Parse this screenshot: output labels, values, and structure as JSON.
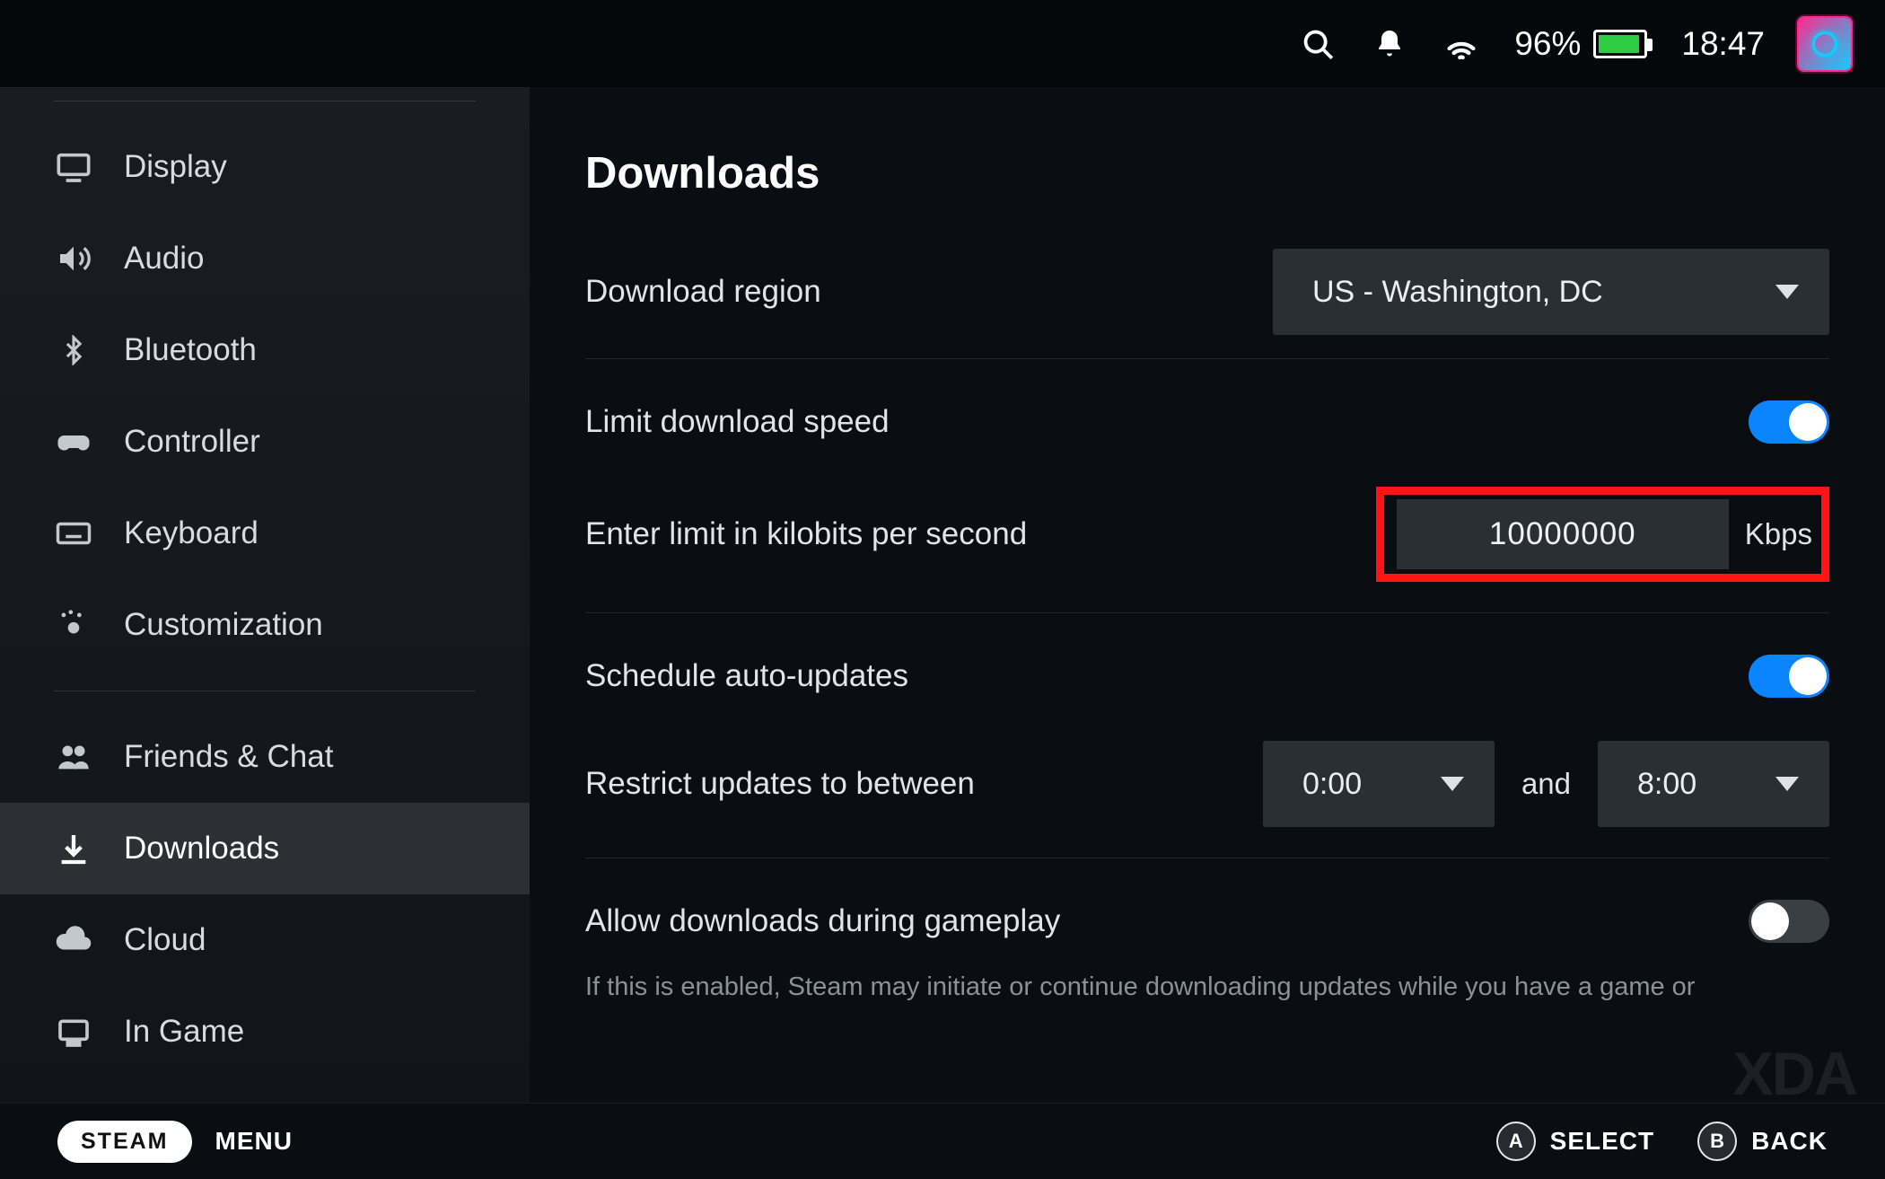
{
  "status": {
    "battery_pct": "96%",
    "battery_fill_pct": 96,
    "time": "18:47"
  },
  "sidebar": {
    "items": [
      {
        "label": "Display",
        "icon": "display-icon"
      },
      {
        "label": "Audio",
        "icon": "audio-icon"
      },
      {
        "label": "Bluetooth",
        "icon": "bluetooth-icon"
      },
      {
        "label": "Controller",
        "icon": "controller-icon"
      },
      {
        "label": "Keyboard",
        "icon": "keyboard-icon"
      },
      {
        "label": "Customization",
        "icon": "customization-icon"
      },
      {
        "label": "Friends & Chat",
        "icon": "friends-icon"
      },
      {
        "label": "Downloads",
        "icon": "download-icon",
        "active": true
      },
      {
        "label": "Cloud",
        "icon": "cloud-icon"
      },
      {
        "label": "In Game",
        "icon": "ingame-icon"
      }
    ]
  },
  "page": {
    "title": "Downloads",
    "region_label": "Download region",
    "region_value": "US - Washington, DC",
    "limit_toggle_label": "Limit download speed",
    "limit_toggle_on": true,
    "limit_input_label": "Enter limit in kilobits per second",
    "limit_input_value": "10000000",
    "limit_unit": "Kbps",
    "schedule_label": "Schedule auto-updates",
    "schedule_toggle_on": true,
    "restrict_label": "Restrict updates to between",
    "restrict_from": "0:00",
    "restrict_and": "and",
    "restrict_to": "8:00",
    "gameplay_label": "Allow downloads during gameplay",
    "gameplay_toggle_on": false,
    "gameplay_help": "If this is enabled, Steam may initiate or continue downloading updates while you have a game or"
  },
  "footer": {
    "steam": "STEAM",
    "menu": "MENU",
    "a_key": "A",
    "a_label": "SELECT",
    "b_key": "B",
    "b_label": "BACK"
  },
  "watermark": "XDA"
}
